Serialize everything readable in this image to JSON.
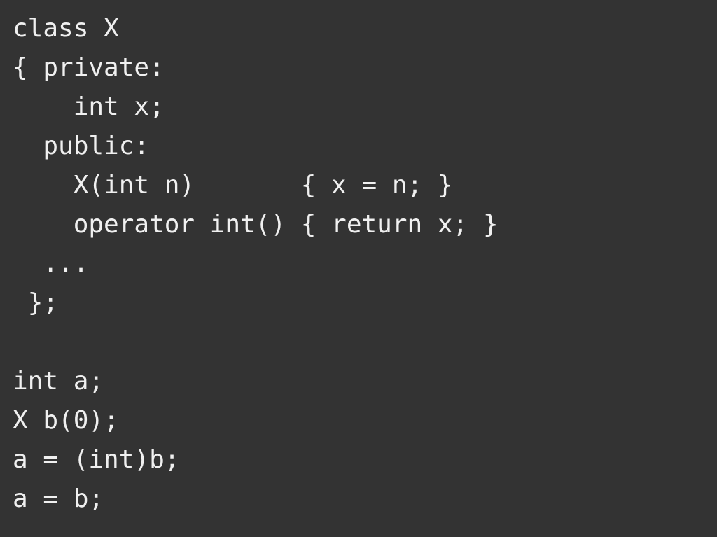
{
  "code": {
    "lines": [
      "class X",
      "{ private:",
      "    int x;",
      "  public:",
      "    X(int n)       { x = n; }",
      "    operator int() { return x; }",
      "  ...",
      " };",
      "",
      "int a;",
      "X b(0);",
      "a = (int)b;",
      "a = b;"
    ]
  }
}
